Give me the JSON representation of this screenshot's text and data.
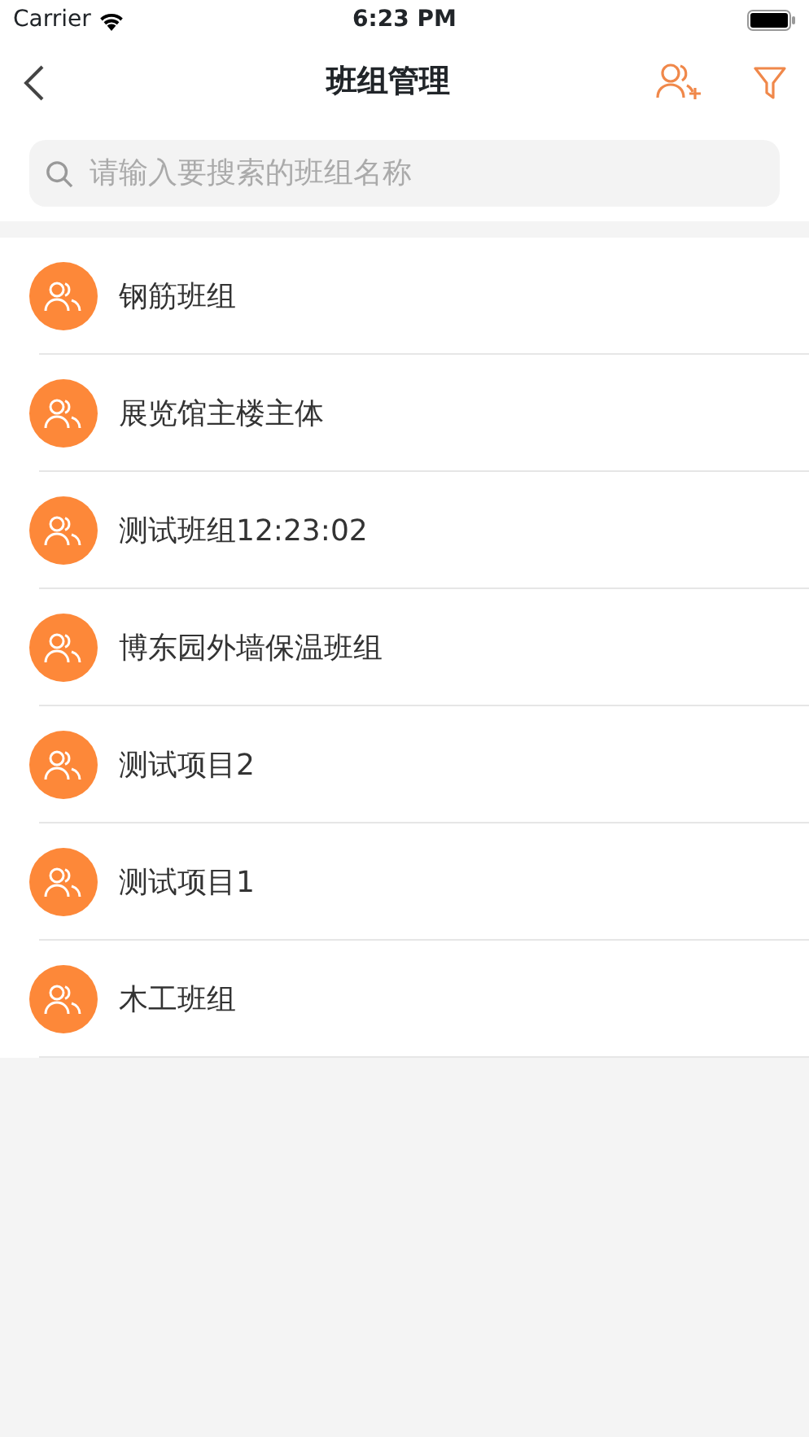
{
  "status_bar": {
    "carrier": "Carrier",
    "time": "6:23 PM"
  },
  "nav_bar": {
    "title": "班组管理"
  },
  "search": {
    "placeholder": "请输入要搜索的班组名称"
  },
  "teams": [
    {
      "name": "钢筋班组"
    },
    {
      "name": "展览馆主楼主体"
    },
    {
      "name": "测试班组12:23:02"
    },
    {
      "name": "博东园外墙保温班组"
    },
    {
      "name": "测试项目2"
    },
    {
      "name": "测试项目1"
    },
    {
      "name": "木工班组"
    }
  ]
}
